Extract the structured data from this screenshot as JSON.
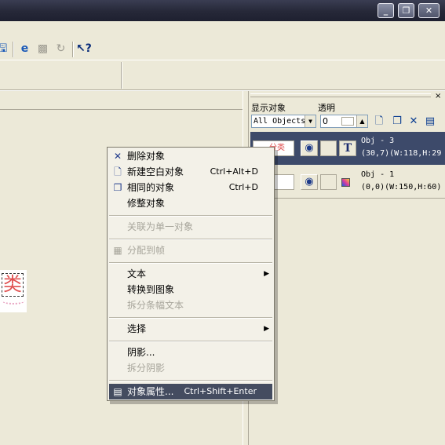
{
  "window": {
    "min_glyph": "_",
    "max_glyph": "❐",
    "close_glyph": "✕"
  },
  "toolbar": {
    "icons": [
      "cursor-help-icon"
    ],
    "help_glyph": "?"
  },
  "canvas": {
    "fragment_char": "类"
  },
  "panel": {
    "show_label": "显示对象",
    "trans_label": "透明",
    "filter_value": "All Objects",
    "trans_value": "0",
    "objects": [
      {
        "name": "Obj - 3",
        "geometry": "(30,7)(W:118,H:29",
        "thumb_text": "分类",
        "type": "T"
      },
      {
        "name": "Obj - 1",
        "geometry": "(0,0)(W:150,H:60)",
        "thumb_text": "",
        "type": "image"
      }
    ]
  },
  "context_menu": {
    "items": {
      "delete": {
        "label": "删除对象"
      },
      "new_blank": {
        "label": "新建空白对象",
        "shortcut": "Ctrl+Alt+D"
      },
      "duplicate": {
        "label": "相同的对象",
        "shortcut": "Ctrl+D"
      },
      "trim": {
        "label": "修整对象"
      },
      "link_single": {
        "label": "关联为单一对象"
      },
      "assign_frame": {
        "label": "分配到帧"
      },
      "text": {
        "label": "文本"
      },
      "to_image": {
        "label": "转换到图象"
      },
      "split_banner": {
        "label": "拆分条幅文本"
      },
      "select": {
        "label": "选择"
      },
      "shadow": {
        "label": "阴影..."
      },
      "split_shadow": {
        "label": "拆分阴影"
      },
      "properties": {
        "label": "对象属性...",
        "shortcut": "Ctrl+Shift+Enter"
      }
    }
  }
}
